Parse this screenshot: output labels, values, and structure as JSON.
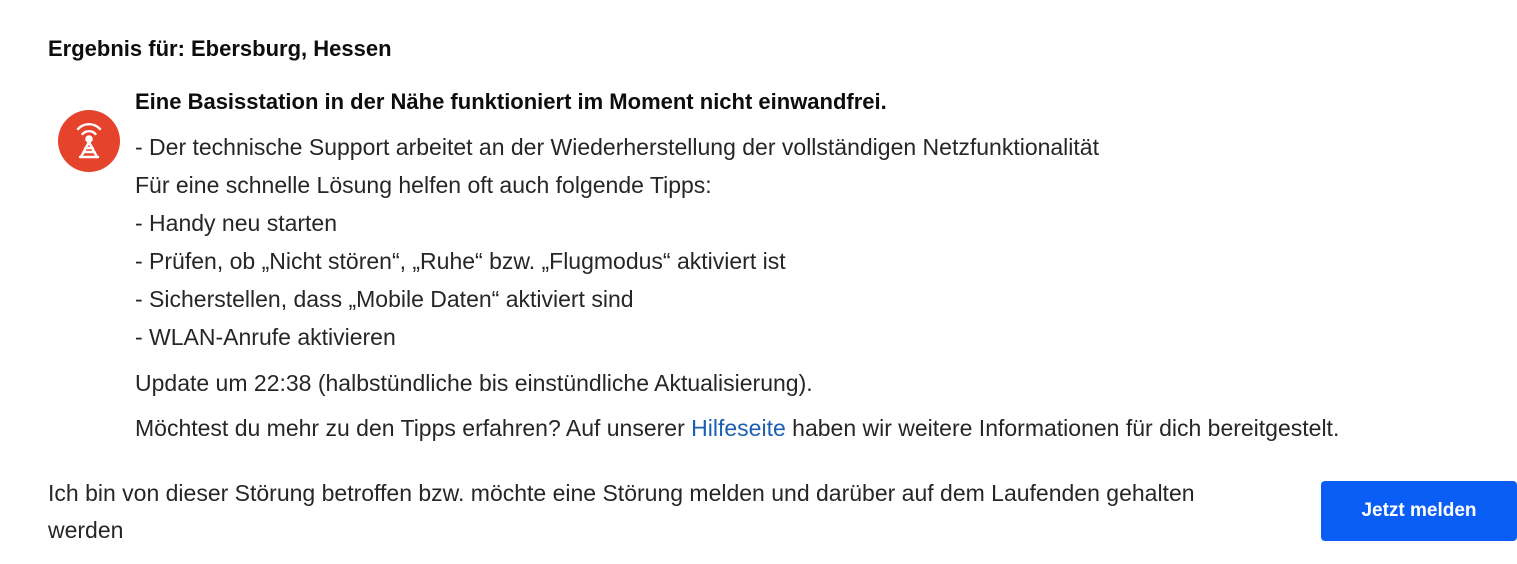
{
  "result": {
    "title": "Ergebnis für: Ebersburg, Hessen"
  },
  "status": {
    "icon": "radio-tower-icon",
    "icon_color": "#e5432b",
    "headline": "Eine Basisstation in der Nähe funktioniert im Moment nicht einwandfrei.",
    "lines": [
      "- Der technische Support arbeitet an der Wiederherstellung der vollständigen Netzfunktionalität",
      "Für eine schnelle Lösung helfen oft auch folgende Tipps:",
      "- Handy neu starten",
      "- Prüfen, ob „Nicht stören“, „Ruhe“ bzw. „Flugmodus“ aktiviert ist",
      "- Sicherstellen, dass „Mobile Daten“ aktiviert sind",
      "- WLAN-Anrufe aktivieren"
    ],
    "update": "Update um 22:38 (halbstündliche bis einstündliche Aktualisierung).",
    "more": {
      "before": "Möchtest du mehr zu den Tipps erfahren? Auf unserer ",
      "link_label": "Hilfeseite",
      "after": " haben wir weitere Informationen für dich bereitgestelt."
    }
  },
  "report": {
    "text": "Ich bin von dieser Störung betroffen bzw. möchte eine Störung melden und darüber auf dem Laufenden gehalten werden",
    "button_label": "Jetzt melden"
  },
  "colors": {
    "link": "#1b5fb5",
    "primary_button": "#0a5ef5"
  }
}
